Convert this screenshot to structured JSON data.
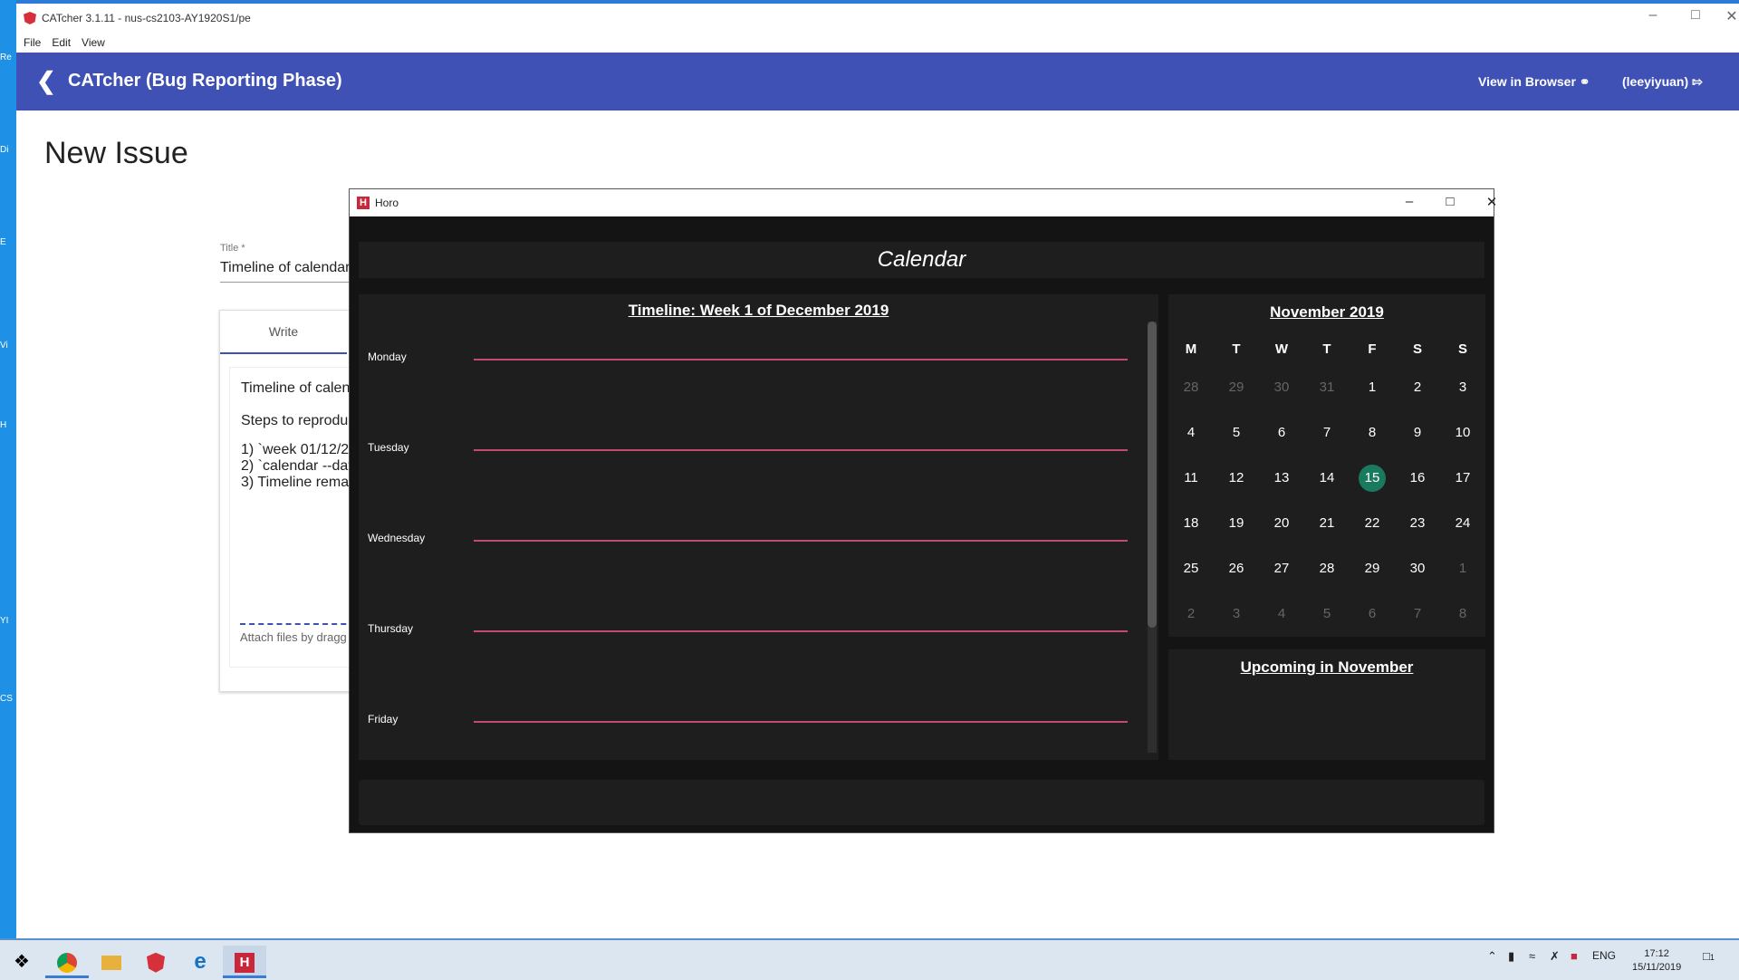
{
  "desktop": {
    "labels": [
      "Re",
      "Di",
      "E",
      "Vi",
      "H",
      "YI",
      "CS"
    ]
  },
  "catcher": {
    "window_title": "CATcher 3.1.11 - nus-cs2103-AY1920S1/pe",
    "menu": [
      "File",
      "Edit",
      "View"
    ],
    "toolbar": {
      "title": "CATcher  (Bug Reporting Phase)",
      "view_in_browser": "View in Browser",
      "user": "(leeyiyuan)"
    },
    "page_title": "New Issue",
    "form": {
      "title_label": "Title *",
      "title_value": "Timeline of calendar",
      "write_tab": "Write",
      "body_lines": [
        "Timeline of calen",
        "Steps to reproduc",
        "1) `week 01/12/2",
        "2) `calendar --dat",
        "3) Timeline rema"
      ],
      "attach_text": "Attach files by dragg"
    }
  },
  "horo": {
    "window_title": "Horo",
    "header": "Calendar",
    "timeline": {
      "title": "Timeline: Week 1 of December 2019",
      "days": [
        "Monday",
        "Tuesday",
        "Wednesday",
        "Thursday",
        "Friday"
      ]
    },
    "calendar": {
      "title": "November 2019",
      "weekdays": [
        "M",
        "T",
        "W",
        "T",
        "F",
        "S",
        "S"
      ],
      "weeks": [
        [
          "28",
          "29",
          "30",
          "31",
          "1",
          "2",
          "3"
        ],
        [
          "4",
          "5",
          "6",
          "7",
          "8",
          "9",
          "10"
        ],
        [
          "11",
          "12",
          "13",
          "14",
          "15",
          "16",
          "17"
        ],
        [
          "18",
          "19",
          "20",
          "21",
          "22",
          "23",
          "24"
        ],
        [
          "25",
          "26",
          "27",
          "28",
          "29",
          "30",
          "1"
        ],
        [
          "2",
          "3",
          "4",
          "5",
          "6",
          "7",
          "8"
        ]
      ],
      "muted": [
        [
          0,
          0
        ],
        [
          0,
          1
        ],
        [
          0,
          2
        ],
        [
          0,
          3
        ],
        [
          4,
          6
        ],
        [
          5,
          0
        ],
        [
          5,
          1
        ],
        [
          5,
          2
        ],
        [
          5,
          3
        ],
        [
          5,
          4
        ],
        [
          5,
          5
        ],
        [
          5,
          6
        ]
      ],
      "today": "15",
      "today_color": "#1a7a5e"
    },
    "upcoming": {
      "title": "Upcoming in November"
    }
  },
  "taskbar": {
    "apps": [
      "start-icon",
      "chrome-icon",
      "file-explorer-icon",
      "angular-icon",
      "edge-icon",
      "horo-icon"
    ],
    "lang": "ENG",
    "time": "17:12",
    "date": "15/11/2019",
    "notifications": "1"
  },
  "colors": {
    "catcher_toolbar": "#3f51b5",
    "horo_bg": "#141414",
    "timeline_line": "#c04c6e",
    "desktop": "#1a8fe3"
  }
}
